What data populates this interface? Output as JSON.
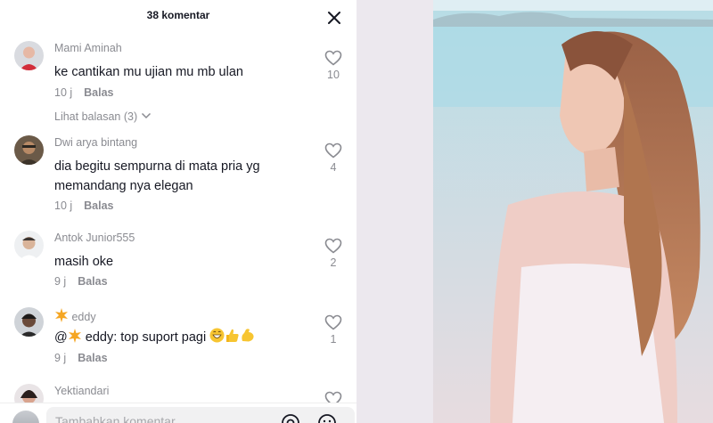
{
  "header": {
    "title": "38 komentar"
  },
  "comments": [
    {
      "author": "Mami Aminah",
      "text": "ke cantikan mu ujian mu mb ulan",
      "time": "10 j",
      "reply_label": "Balas",
      "likes": "10",
      "view_replies": "Lihat balasan (3)"
    },
    {
      "author": "Dwi arya bintang",
      "text_line1": "dia begitu sempurna di mata pria yg",
      "text_line2": "memandang nya elegan",
      "time": "10 j",
      "reply_label": "Balas",
      "likes": "4"
    },
    {
      "author": "Antok Junior555",
      "text": "masih oke",
      "time": "9 j",
      "reply_label": "Balas",
      "likes": "2"
    },
    {
      "author": "eddy",
      "text_prefix": "@",
      "text_body": " eddy: top suport pagi ",
      "time": "9 j",
      "reply_label": "Balas",
      "likes": "1"
    },
    {
      "author": "Yektiandari"
    }
  ],
  "input": {
    "placeholder": "Tambahkan komentar..."
  },
  "icons": {
    "close": "close-icon",
    "like": "heart-outline-icon",
    "chevron": "chevron-down-icon",
    "mention": "at-sign-icon",
    "emoji": "smile-icon"
  },
  "colors": {
    "text_primary": "#161823",
    "text_secondary": "#8a8b91",
    "input_bg": "#f1f1f2"
  }
}
